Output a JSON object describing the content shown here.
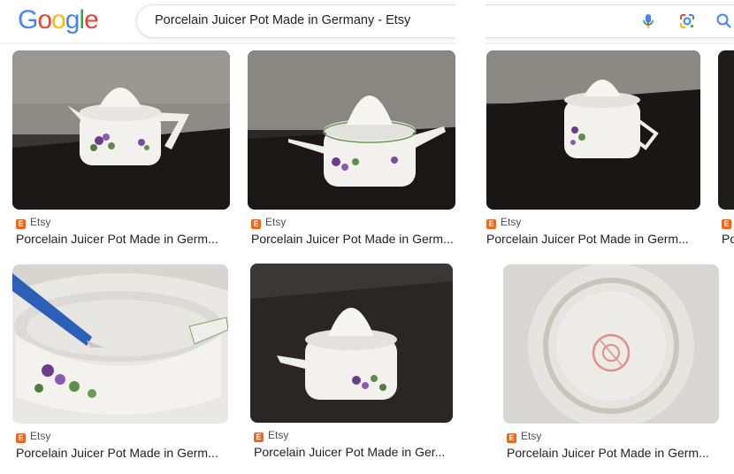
{
  "header": {
    "logo_letters": [
      {
        "char": "G",
        "color": "#4285F4"
      },
      {
        "char": "o",
        "color": "#EA4335"
      },
      {
        "char": "o",
        "color": "#FBBC05"
      },
      {
        "char": "g",
        "color": "#4285F4"
      },
      {
        "char": "l",
        "color": "#34A853"
      },
      {
        "char": "e",
        "color": "#EA4335"
      }
    ],
    "search_query": "Porcelain Juicer Pot Made in Germany - Etsy",
    "icons": [
      "mic-icon",
      "google-lens-icon",
      "search-icon"
    ]
  },
  "results": [
    {
      "source": "Etsy",
      "favicon": "E",
      "title": "Porcelain Juicer Pot Made in Germ...",
      "image": "teapot juicer front, dark table"
    },
    {
      "source": "Etsy",
      "favicon": "E",
      "title": "Porcelain Juicer Pot Made in Germ...",
      "image": "teapot juicer side, dark table"
    },
    {
      "source": "Etsy",
      "favicon": "E",
      "title": "Porcelain Juicer Pot Made in Germ...",
      "image": "teapot juicer handle view"
    },
    {
      "source": "Et",
      "favicon": "E",
      "title": "Po",
      "image": "partially visible"
    },
    {
      "source": "Etsy",
      "favicon": "E",
      "title": "Porcelain Juicer Pot Made in Germ...",
      "image": "inside of pot with pen"
    },
    {
      "source": "Etsy",
      "favicon": "E",
      "title": "Porcelain Juicer Pot Made in Ger...",
      "image": "juicer spout view"
    },
    {
      "source": "Etsy",
      "favicon": "E",
      "title": "Porcelain Juicer Pot Made in Germ...",
      "image": "bottom stamp mark"
    }
  ],
  "colors": {
    "etsy_orange": "#F1641E",
    "text_primary": "#202124",
    "text_secondary": "#4D5156"
  }
}
